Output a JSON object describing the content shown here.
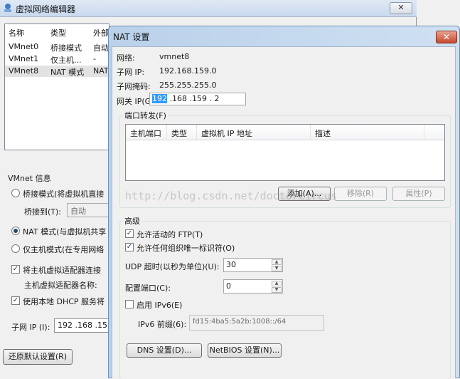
{
  "background_window": {
    "title": "虚拟网络编辑器",
    "close": "✕",
    "columns": [
      "名称",
      "类型",
      "外部"
    ],
    "rows": [
      {
        "name": "VMnet0",
        "type": "桥接模式",
        "ext": "自动"
      },
      {
        "name": "VMnet1",
        "type": "仅主机...",
        "ext": "-"
      },
      {
        "name": "VMnet8",
        "type": "NAT 模式",
        "ext": "NAT"
      }
    ],
    "vmnet_info_label": "VMnet 信息",
    "radio_bridge": "桥接模式(将虚拟机直接",
    "bridge_to_label": "桥接到(T):",
    "bridge_to_value": "自动",
    "radio_nat": "NAT 模式(与虚拟机共享",
    "radio_host_only": "仅主机模式(在专用网络",
    "check_connect_adapter": "将主机虚拟适配器连接",
    "adapter_name_label": "主机虚拟适配器名称: ",
    "check_dhcp": "使用本地 DHCP 服务将",
    "subnet_ip_label": "子网 IP (I):",
    "subnet_ip_value": "192 .168 .15",
    "restore_button": "还原默认设置(R)"
  },
  "dialog": {
    "title": "NAT 设置",
    "close": "✕",
    "network_label": "网络:",
    "network_value": "vmnet8",
    "subnet_ip_label": "子网 IP:",
    "subnet_ip_value": "192.168.159.0",
    "subnet_mask_label": "子网掩码:",
    "subnet_mask_value": "255.255.255.0",
    "gateway_label": "网关 IP(G):",
    "gateway_selected": "192",
    "gateway_rest": " .168 .159 . 2",
    "port_forwarding_label": "端口转发(F)",
    "pf_columns": [
      "主机端口",
      "类型",
      "虚拟机 IP 地址",
      "描述"
    ],
    "add_button": "添加(A)...",
    "remove_button": "移除(R)",
    "properties_button": "属性(P)",
    "advanced_label": "高级",
    "allow_ftp": "允许活动的 FTP(T)",
    "allow_uid": "允许任何组织唯一标识符(O)",
    "udp_timeout_label": "UDP 超时(以秒为单位)(U):",
    "udp_timeout_value": "30",
    "config_port_label": "配置端口(C):",
    "config_port_value": "0",
    "enable_ipv6": "启用 IPv6(E)",
    "ipv6_prefix_label": "IPv6 前缀(6):",
    "ipv6_prefix_value": "fd15:4ba5:5a2b:1008::/64",
    "dns_button": "DNS 设置(D)...",
    "netbios_button": "NetBIOS 设置(N)..."
  },
  "watermark": "http://blog.csdn.net/doctorcircus"
}
